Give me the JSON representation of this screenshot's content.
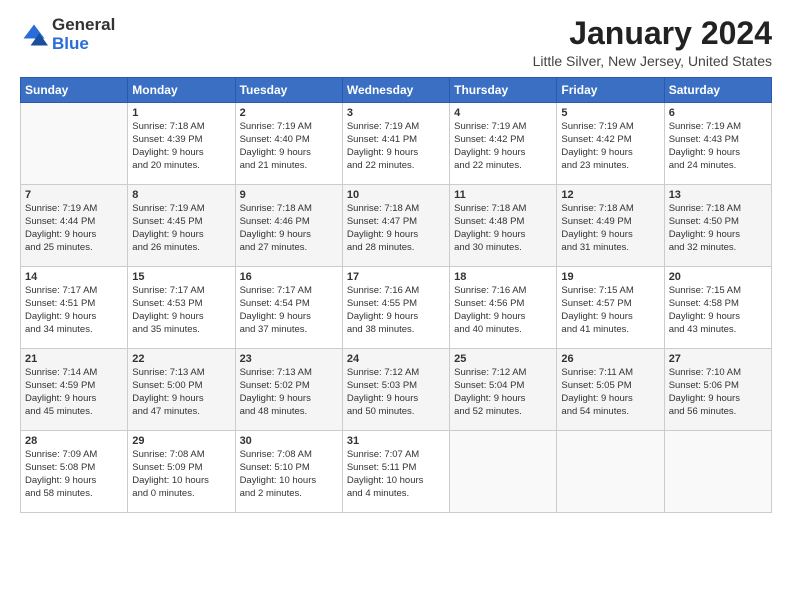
{
  "logo": {
    "general": "General",
    "blue": "Blue"
  },
  "title": "January 2024",
  "location": "Little Silver, New Jersey, United States",
  "days_of_week": [
    "Sunday",
    "Monday",
    "Tuesday",
    "Wednesday",
    "Thursday",
    "Friday",
    "Saturday"
  ],
  "weeks": [
    [
      {
        "day": "",
        "data": ""
      },
      {
        "day": "1",
        "data": "Sunrise: 7:18 AM\nSunset: 4:39 PM\nDaylight: 9 hours\nand 20 minutes."
      },
      {
        "day": "2",
        "data": "Sunrise: 7:19 AM\nSunset: 4:40 PM\nDaylight: 9 hours\nand 21 minutes."
      },
      {
        "day": "3",
        "data": "Sunrise: 7:19 AM\nSunset: 4:41 PM\nDaylight: 9 hours\nand 22 minutes."
      },
      {
        "day": "4",
        "data": "Sunrise: 7:19 AM\nSunset: 4:42 PM\nDaylight: 9 hours\nand 22 minutes."
      },
      {
        "day": "5",
        "data": "Sunrise: 7:19 AM\nSunset: 4:42 PM\nDaylight: 9 hours\nand 23 minutes."
      },
      {
        "day": "6",
        "data": "Sunrise: 7:19 AM\nSunset: 4:43 PM\nDaylight: 9 hours\nand 24 minutes."
      }
    ],
    [
      {
        "day": "7",
        "data": "Sunrise: 7:19 AM\nSunset: 4:44 PM\nDaylight: 9 hours\nand 25 minutes."
      },
      {
        "day": "8",
        "data": "Sunrise: 7:19 AM\nSunset: 4:45 PM\nDaylight: 9 hours\nand 26 minutes."
      },
      {
        "day": "9",
        "data": "Sunrise: 7:18 AM\nSunset: 4:46 PM\nDaylight: 9 hours\nand 27 minutes."
      },
      {
        "day": "10",
        "data": "Sunrise: 7:18 AM\nSunset: 4:47 PM\nDaylight: 9 hours\nand 28 minutes."
      },
      {
        "day": "11",
        "data": "Sunrise: 7:18 AM\nSunset: 4:48 PM\nDaylight: 9 hours\nand 30 minutes."
      },
      {
        "day": "12",
        "data": "Sunrise: 7:18 AM\nSunset: 4:49 PM\nDaylight: 9 hours\nand 31 minutes."
      },
      {
        "day": "13",
        "data": "Sunrise: 7:18 AM\nSunset: 4:50 PM\nDaylight: 9 hours\nand 32 minutes."
      }
    ],
    [
      {
        "day": "14",
        "data": "Sunrise: 7:17 AM\nSunset: 4:51 PM\nDaylight: 9 hours\nand 34 minutes."
      },
      {
        "day": "15",
        "data": "Sunrise: 7:17 AM\nSunset: 4:53 PM\nDaylight: 9 hours\nand 35 minutes."
      },
      {
        "day": "16",
        "data": "Sunrise: 7:17 AM\nSunset: 4:54 PM\nDaylight: 9 hours\nand 37 minutes."
      },
      {
        "day": "17",
        "data": "Sunrise: 7:16 AM\nSunset: 4:55 PM\nDaylight: 9 hours\nand 38 minutes."
      },
      {
        "day": "18",
        "data": "Sunrise: 7:16 AM\nSunset: 4:56 PM\nDaylight: 9 hours\nand 40 minutes."
      },
      {
        "day": "19",
        "data": "Sunrise: 7:15 AM\nSunset: 4:57 PM\nDaylight: 9 hours\nand 41 minutes."
      },
      {
        "day": "20",
        "data": "Sunrise: 7:15 AM\nSunset: 4:58 PM\nDaylight: 9 hours\nand 43 minutes."
      }
    ],
    [
      {
        "day": "21",
        "data": "Sunrise: 7:14 AM\nSunset: 4:59 PM\nDaylight: 9 hours\nand 45 minutes."
      },
      {
        "day": "22",
        "data": "Sunrise: 7:13 AM\nSunset: 5:00 PM\nDaylight: 9 hours\nand 47 minutes."
      },
      {
        "day": "23",
        "data": "Sunrise: 7:13 AM\nSunset: 5:02 PM\nDaylight: 9 hours\nand 48 minutes."
      },
      {
        "day": "24",
        "data": "Sunrise: 7:12 AM\nSunset: 5:03 PM\nDaylight: 9 hours\nand 50 minutes."
      },
      {
        "day": "25",
        "data": "Sunrise: 7:12 AM\nSunset: 5:04 PM\nDaylight: 9 hours\nand 52 minutes."
      },
      {
        "day": "26",
        "data": "Sunrise: 7:11 AM\nSunset: 5:05 PM\nDaylight: 9 hours\nand 54 minutes."
      },
      {
        "day": "27",
        "data": "Sunrise: 7:10 AM\nSunset: 5:06 PM\nDaylight: 9 hours\nand 56 minutes."
      }
    ],
    [
      {
        "day": "28",
        "data": "Sunrise: 7:09 AM\nSunset: 5:08 PM\nDaylight: 9 hours\nand 58 minutes."
      },
      {
        "day": "29",
        "data": "Sunrise: 7:08 AM\nSunset: 5:09 PM\nDaylight: 10 hours\nand 0 minutes."
      },
      {
        "day": "30",
        "data": "Sunrise: 7:08 AM\nSunset: 5:10 PM\nDaylight: 10 hours\nand 2 minutes."
      },
      {
        "day": "31",
        "data": "Sunrise: 7:07 AM\nSunset: 5:11 PM\nDaylight: 10 hours\nand 4 minutes."
      },
      {
        "day": "",
        "data": ""
      },
      {
        "day": "",
        "data": ""
      },
      {
        "day": "",
        "data": ""
      }
    ]
  ]
}
